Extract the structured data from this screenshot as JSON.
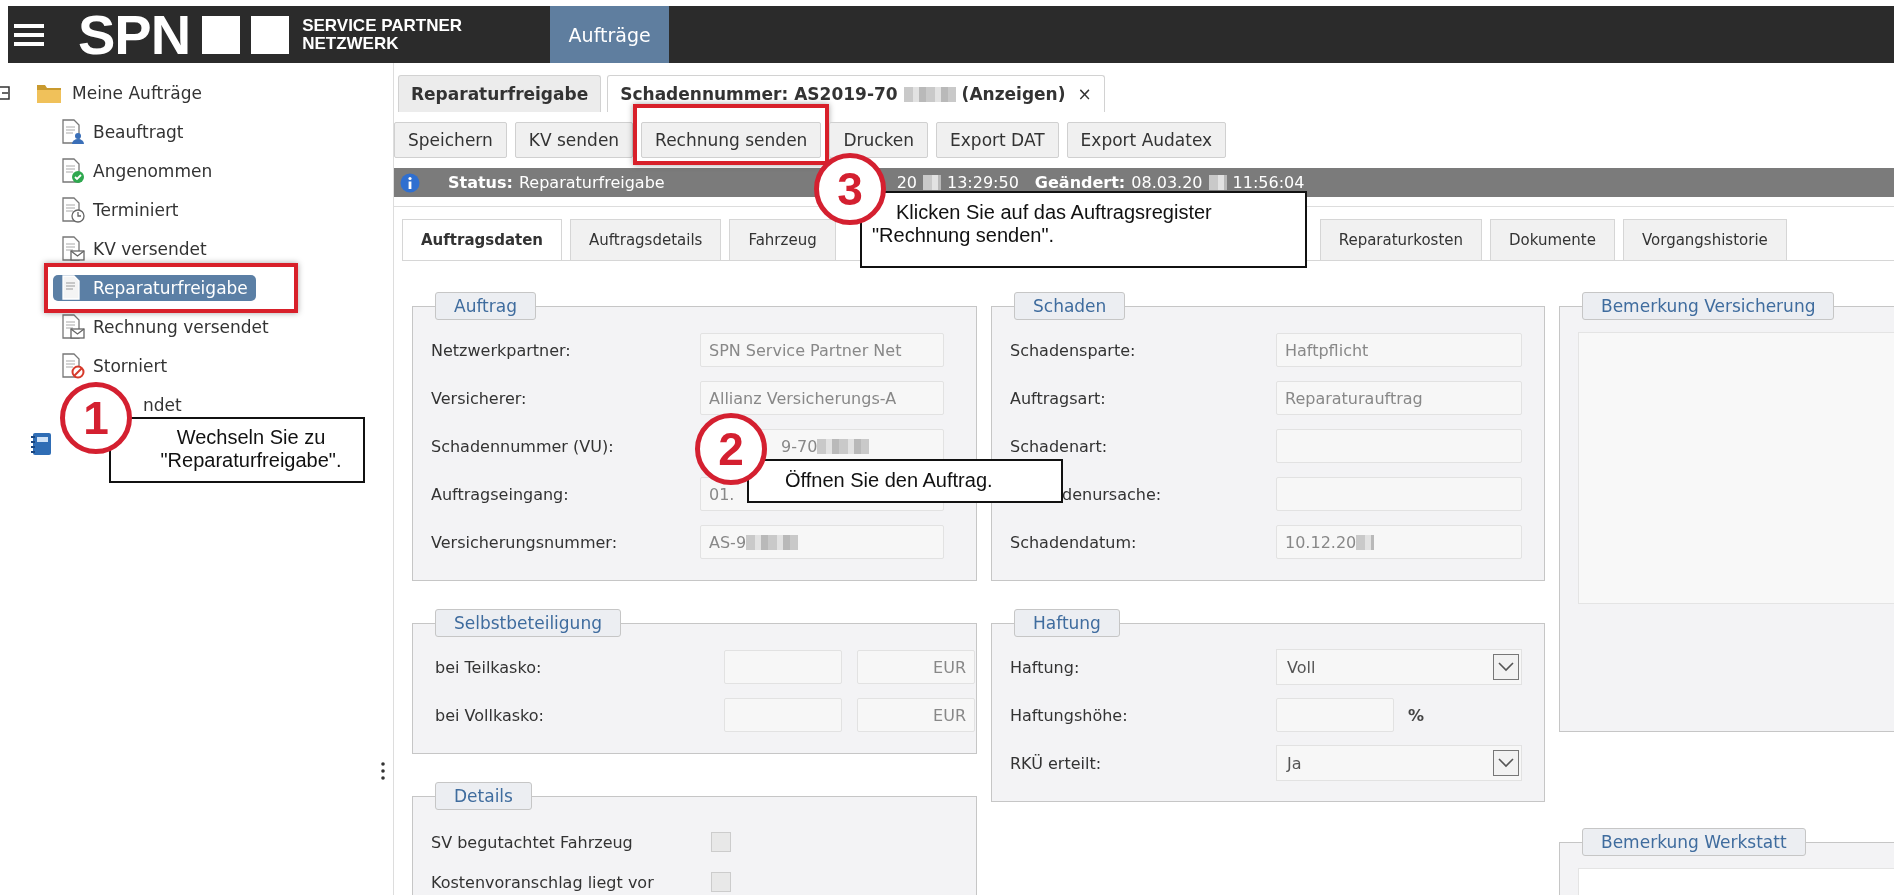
{
  "topbar": {
    "logo_mark": "SPN",
    "logo_lines": [
      "SERVICE PARTNER",
      "NETZWERK"
    ],
    "nav": [
      {
        "label": "Aufträge",
        "selected": true
      }
    ]
  },
  "sidebar": {
    "trees": [
      {
        "kind": "folder",
        "label": "Meine Aufträge",
        "expanded": true,
        "children": [
          {
            "label": "Beauftragt",
            "selected": false
          },
          {
            "label": "Angenommen",
            "selected": false
          },
          {
            "label": "Terminiert",
            "selected": false
          },
          {
            "label": "KV versendet",
            "selected": false
          },
          {
            "label": "Reparaturfreigabe",
            "selected": true
          },
          {
            "label": "Rechnung versendet",
            "selected": false
          },
          {
            "label": "Storniert",
            "selected": false
          },
          {
            "label": "ndet",
            "selected": false,
            "clipped": true
          }
        ]
      },
      {
        "kind": "notebook"
      }
    ]
  },
  "doc_tabs": [
    {
      "label": "Reparaturfreigabe",
      "selected": false
    },
    {
      "label": "Schadennummer: AS2019-70",
      "redacted": true,
      "suffix": "(Anzeigen)",
      "close": "×",
      "selected": true
    }
  ],
  "toolbar": [
    "Speichern",
    "KV senden",
    "Rechnung senden",
    "Drucken",
    "Export DAT",
    "Export Audatex"
  ],
  "status_bar": [
    {
      "label": "Status:",
      "value": "Reparaturfreigabe"
    },
    {
      "value": "20",
      "redacted": true,
      "time": "13:29:50"
    },
    {
      "label": "Geändert:",
      "value": "08.03.20",
      "redacted": true,
      "time": "11:56:04"
    }
  ],
  "tabs": [
    {
      "label": "Auftragsdaten",
      "selected": true
    },
    {
      "label": "Auftragsdetails",
      "selected": false
    },
    {
      "label": "Fahrzeug",
      "selected": false
    },
    {
      "label": "Reparaturkosten",
      "selected": false
    },
    {
      "label": "Dokumente",
      "selected": false
    },
    {
      "label": "Vorgangshistorie",
      "selected": false
    }
  ],
  "auftrag": {
    "title": "Auftrag",
    "rows": [
      {
        "label": "Netzwerkpartner:",
        "value": "SPN Service Partner Net"
      },
      {
        "label": "Versicherer:",
        "value": "Allianz Versicherungs-A"
      },
      {
        "label": "Schadennummer (VU):",
        "value": "9-70",
        "redacted": true,
        "value_clipped": true
      },
      {
        "label": "Auftragseingang:",
        "value": "01."
      },
      {
        "label": "Versicherungsnummer:",
        "value": "AS-9",
        "redacted": true
      }
    ]
  },
  "schaden": {
    "title": "Schaden",
    "rows": [
      {
        "label": "Schadensparte:",
        "value": "Haftpflicht"
      },
      {
        "label": "Auftragsart:",
        "value": "Reparaturauftrag"
      },
      {
        "label": "Schadenart:"
      },
      {
        "label": "denursache:",
        "label_clipped": true
      },
      {
        "label": "Schadendatum:",
        "value": "10.12.20",
        "redacted": true
      }
    ]
  },
  "selbstbeteiligung": {
    "title": "Selbstbeteiligung",
    "rows": [
      {
        "label": "bei Teilkasko:",
        "unit": "EUR"
      },
      {
        "label": "bei Vollkasko:",
        "unit": "EUR"
      }
    ]
  },
  "haftung": {
    "title": "Haftung",
    "rows": [
      {
        "kind": "select",
        "label": "Haftung:",
        "value": "Voll"
      },
      {
        "kind": "percent",
        "label": "Haftungshöhe:",
        "unit": "%"
      },
      {
        "kind": "select",
        "label": "RKÜ erteilt:",
        "value": "Ja"
      }
    ]
  },
  "details": {
    "title": "Details",
    "rows": [
      {
        "label": "SV begutachtet Fahrzeug",
        "checked": false
      },
      {
        "label": "Kostenvoranschlag liegt vor",
        "checked": false
      }
    ]
  },
  "remarks": [
    {
      "title": "Bemerkung Versicherung"
    },
    {
      "title": "Bemerkung Werkstatt"
    }
  ],
  "callouts": [
    {
      "number": "1",
      "lines": [
        "Wechseln Sie zu",
        "\"Reparaturfreigabe\"."
      ]
    },
    {
      "number": "2",
      "lines": [
        "Öffnen Sie den Auftrag."
      ]
    },
    {
      "number": "3",
      "lines": [
        "Klicken Sie auf das Auftragsregister",
        "\"Rechnung senden\"."
      ]
    }
  ]
}
